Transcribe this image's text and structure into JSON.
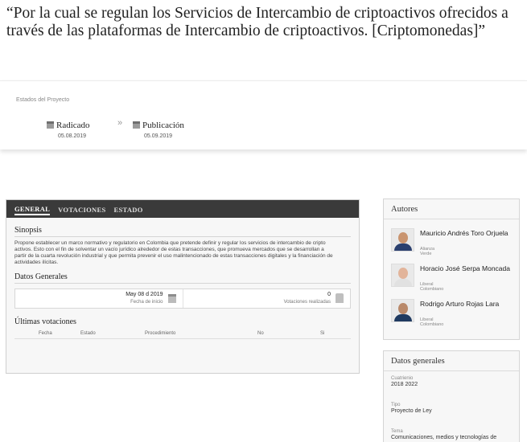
{
  "project": {
    "title": "“Por la cual se regulan los Servicios de Intercambio de criptoactivos ofrecidos a través de las plataformas de Intercambio de criptoactivos. [Criptomonedas]”"
  },
  "states": {
    "label": "Estados del Proyecto",
    "separator": "»",
    "steps": [
      {
        "name": "Radicado",
        "date": "05.08.2019"
      },
      {
        "name": "Publicación",
        "date": "05.09.2019"
      }
    ]
  },
  "tabs": [
    {
      "label": "GENERAL"
    },
    {
      "label": "VOTACIONES"
    },
    {
      "label": "ESTADO"
    }
  ],
  "general": {
    "synopsis_title": "Sinopsis",
    "synopsis_text": "Propone establecer un marco normativo y regulatorio en Colombia que pretende definir y regular los servicios de intercambio de cripto activos. Esto con el fin de solventar un vacío jurídico alrededor de estas transacciones, que promueva mercados que se desarrollan a partir de la cuarta revolución industrial y que permita prevenir el uso malintencionado de estas transacciones digitales y la financiación de actividades ilícitas.",
    "datos_title": "Datos Generales",
    "start_date_value": "May 08 d 2019",
    "start_date_label": "Fecha de inicio",
    "votes_value": "0",
    "votes_label": "Votaciones realizadas",
    "last_votes_title": "Últimas votaciones",
    "vote_columns": [
      "Fecha",
      "Estado",
      "Procedimiento",
      "No",
      "Si"
    ]
  },
  "authors": {
    "title": "Autores",
    "items": [
      {
        "name": "Mauricio Andrés Toro Orjuela",
        "party": "Alianza Verde"
      },
      {
        "name": "Horacio José Serpa Moncada",
        "party": "Liberal Colombiano"
      },
      {
        "name": "Rodrigo Arturo Rojas Lara",
        "party": "Liberal Colombiano"
      }
    ]
  },
  "datos_generales": {
    "title": "Datos generales",
    "cuatrienio_label": "Cuatrienio",
    "cuatrienio_value": "2018 2022",
    "tipo_label": "Tipo",
    "tipo_value": "Proyecto de Ley",
    "tema_label": "Tema",
    "tema_value": "Comunicaciones, medios y tecnologías de"
  }
}
